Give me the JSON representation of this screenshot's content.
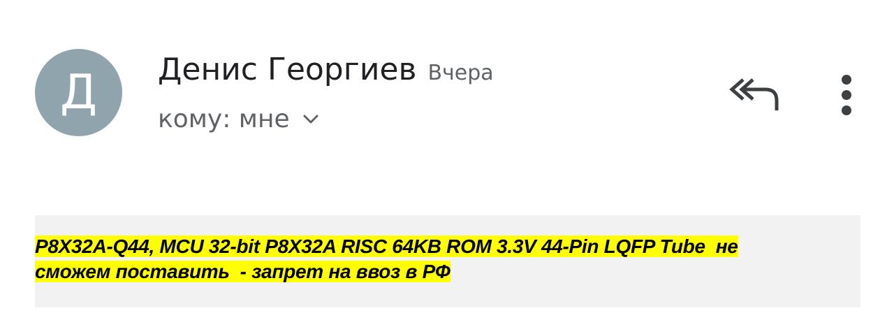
{
  "header": {
    "avatar_letter": "Д",
    "avatar_color": "#90a4ae",
    "sender_name": "Денис Георгиев",
    "date": "Вчера",
    "recipient": "кому: мне",
    "expand_icon": "chevron-down-icon",
    "reply_all_icon": "reply-all-icon",
    "more_icon": "more-vert-icon"
  },
  "message": {
    "line1": "P8X32A-Q44, MCU 32-bit P8X32A RISC 64KB ROM 3.3V 44-Pin LQFP Tube  не",
    "line2": "сможем поставить  - запрет на ввоз в РФ",
    "highlight_color": "#ffff00",
    "box_color": "#f2f2f2"
  }
}
